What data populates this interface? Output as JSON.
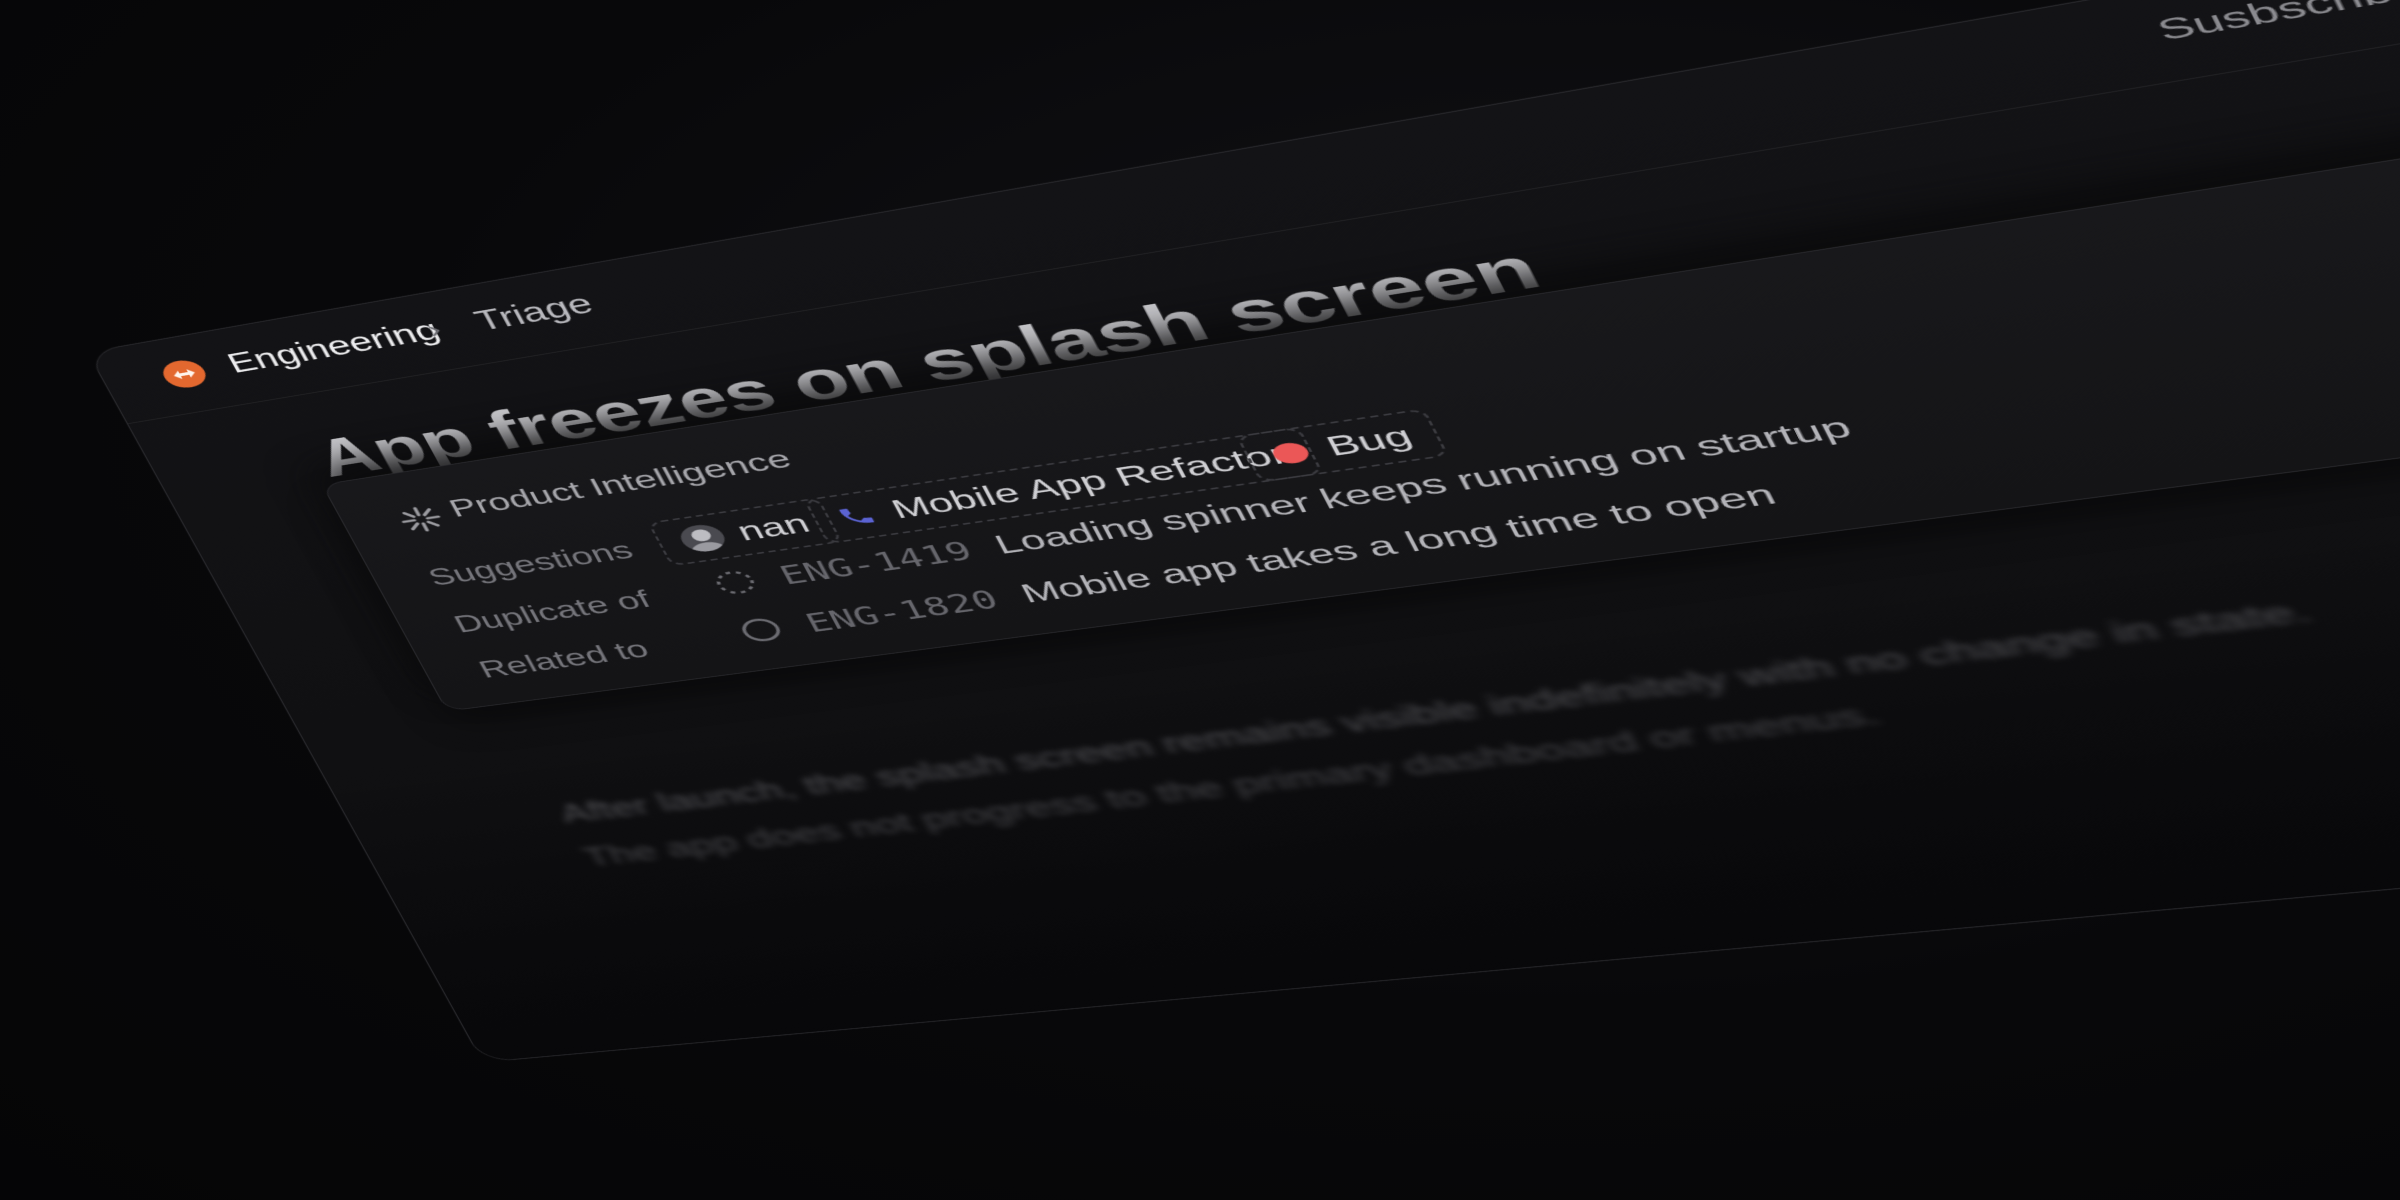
{
  "breadcrumb": {
    "team": "Engineering",
    "separator": "›",
    "page": "Triage"
  },
  "topbar": {
    "subscribe_label": "Susbscribe",
    "avatar_colors": [
      "#9a7e63",
      "#c9c4bd",
      "#6d6d74",
      "#8a8f87"
    ]
  },
  "issue": {
    "title": "App freezes on splash screen",
    "description": [
      "After launch, the splash screen remains visible indefinitely with no change in state.",
      "The app does not progress to the primary dashboard or menus."
    ]
  },
  "intelligence": {
    "header": "Product Intelligence",
    "suggestions_label": "Suggestions",
    "duplicate_label": "Duplicate of",
    "related_label": "Related to",
    "suggestions": {
      "assignee": "nan",
      "project": "Mobile App Refactor",
      "label": "Bug"
    },
    "duplicate": {
      "id": "ENG-1419",
      "title": "Loading spinner keeps running on startup"
    },
    "related": {
      "id": "ENG-1820",
      "title": "Mobile app takes a long time to open"
    }
  },
  "colors": {
    "team_logo": "#e3682f",
    "bug_dot": "#eb5757",
    "project_icon": "#5b63d3"
  }
}
